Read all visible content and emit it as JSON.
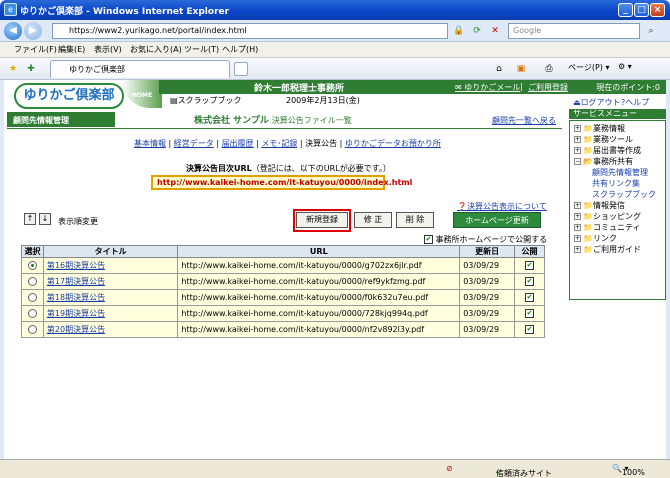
{
  "window": {
    "title": "ゆりかご倶楽部 - Windows Internet Explorer"
  },
  "address": {
    "url": "https://www2.yurikago.net/portal/index.html",
    "search_placeholder": "Google"
  },
  "menu": [
    "ファイル(F)",
    "編集(E)",
    "表示(V)",
    "お気に入り(A)",
    "ツール(T)",
    "ヘルプ(H)"
  ],
  "tab": {
    "label": "ゆりかご倶楽部"
  },
  "toolbar": {
    "page_label": "ページ(P)",
    "tools_label": "▾"
  },
  "header": {
    "logo": "ゆりかご倶楽部",
    "home": "HOME",
    "office": "鈴木一郎税理士事務所",
    "mail_link": "ゆりかごメール",
    "divider": "|",
    "register_link": "ご利用登録",
    "points": "現在のポイント:0",
    "scrapbook": "スクラップブック",
    "date": "2009年2月13日(金)",
    "logout": "ログアウト",
    "help": "ヘルプ"
  },
  "client": {
    "bar_label": "顧問先情報管理",
    "company": "株式会社 サンプル",
    "page_sub": "決算公告ファイル一覧",
    "back_link": "顧問先一覧へ戻る"
  },
  "subnav": [
    "基本情報",
    "経営データ",
    "届出履歴",
    "メモ･記録",
    "決算公告",
    "ゆりかごデータお預かり所"
  ],
  "url_section": {
    "title": "決算公告目次URL",
    "note": "（登記には、以下のURLが必要です。）",
    "url": "http://www.kaikei-home.com/it-katuyou/0000/index.html"
  },
  "notice_link": "決算公告表示について",
  "sort_label": "表示順変更",
  "buttons": {
    "new": "新規登録",
    "edit": "修 正",
    "delete": "削 除",
    "homepage": "ホームページ更新"
  },
  "publish_check": "事務所ホームページで公開する",
  "table": {
    "headers": [
      "選択",
      "タイトル",
      "URL",
      "更新日",
      "公開"
    ],
    "rows": [
      {
        "title": "第16期決算公告",
        "url": "http://www.kaikei-home.com/it-katuyou/0000/g702zx6jlr.pdf",
        "date": "03/09/29",
        "selected": true,
        "public": true
      },
      {
        "title": "第17期決算公告",
        "url": "http://www.kaikei-home.com/it-katuyou/0000/ref9ykfzmg.pdf",
        "date": "03/09/29",
        "selected": false,
        "public": true
      },
      {
        "title": "第18期決算公告",
        "url": "http://www.kaikei-home.com/it-katuyou/0000/f0k632u7eu.pdf",
        "date": "03/09/29",
        "selected": false,
        "public": true
      },
      {
        "title": "第19期決算公告",
        "url": "http://www.kaikei-home.com/it-katuyou/0000/728kjq994q.pdf",
        "date": "03/09/29",
        "selected": false,
        "public": true
      },
      {
        "title": "第20期決算公告",
        "url": "http://www.kaikei-home.com/it-katuyou/0000/nf2v892l3y.pdf",
        "date": "03/09/29",
        "selected": false,
        "public": true
      }
    ]
  },
  "sidebar": {
    "title": "サービスメニュー",
    "items": [
      "業務情報",
      "業務ツール",
      "届出書等作成",
      "事務所共有",
      "顧問先情報管理",
      "共有リンク集",
      "スクラップブック",
      "情報発信",
      "ショッピング",
      "コミュニティ",
      "リンク",
      "ご利用ガイド"
    ]
  },
  "status": {
    "trusted": "信頼済みサイト",
    "zoom": "100%"
  }
}
